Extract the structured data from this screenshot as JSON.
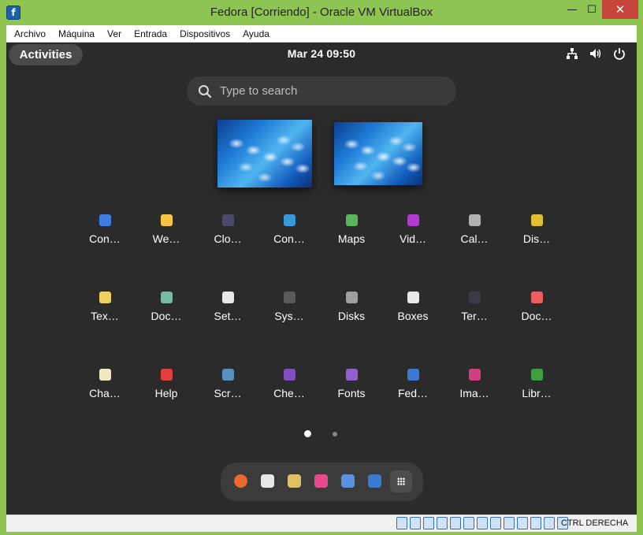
{
  "window": {
    "title": "Fedora [Corriendo] - Oracle VM VirtualBox",
    "minimize": "—",
    "maximize": "☐",
    "close": "✕"
  },
  "menubar": {
    "items": [
      "Archivo",
      "Máquina",
      "Ver",
      "Entrada",
      "Dispositivos",
      "Ayuda"
    ]
  },
  "gnome": {
    "activities_label": "Activities",
    "clock": "Mar 24  09:50",
    "search_placeholder": "Type to search",
    "status_icons": [
      "network-icon",
      "volume-icon",
      "power-icon"
    ]
  },
  "workspaces": [
    "workspace-1",
    "workspace-2"
  ],
  "apps": [
    {
      "label": "Con…",
      "icon": "contacts-icon",
      "color": "#3d7ee0"
    },
    {
      "label": "We…",
      "icon": "weather-icon",
      "color": "#f5c542"
    },
    {
      "label": "Clo…",
      "icon": "clocks-icon",
      "color": "#4a4a6a"
    },
    {
      "label": "Con…",
      "icon": "connections-icon",
      "color": "#3a9ad9"
    },
    {
      "label": "Maps",
      "icon": "maps-icon",
      "color": "#5ab55a"
    },
    {
      "label": "Vid…",
      "icon": "videos-icon",
      "color": "#b03ad0"
    },
    {
      "label": "Cal…",
      "icon": "calculator-icon",
      "color": "#b0b0b0"
    },
    {
      "label": "Dis…",
      "icon": "disk-usage-icon",
      "color": "#e0c030"
    },
    {
      "label": "Tex…",
      "icon": "text-editor-icon",
      "color": "#f0d060"
    },
    {
      "label": "Doc…",
      "icon": "document-scanner-icon",
      "color": "#7ab8a8"
    },
    {
      "label": "Set…",
      "icon": "settings-icon",
      "color": "#e8e8e8"
    },
    {
      "label": "Sys…",
      "icon": "system-monitor-icon",
      "color": "#5a5a5a"
    },
    {
      "label": "Disks",
      "icon": "disks-icon",
      "color": "#a0a0a0"
    },
    {
      "label": "Boxes",
      "icon": "boxes-icon",
      "color": "#e8e8e8"
    },
    {
      "label": "Ter…",
      "icon": "terminal-icon",
      "color": "#3a3a4a"
    },
    {
      "label": "Doc…",
      "icon": "document-viewer-icon",
      "color": "#e86060"
    },
    {
      "label": "Cha…",
      "icon": "characters-icon",
      "color": "#f0e8c0"
    },
    {
      "label": "Help",
      "icon": "help-icon",
      "color": "#e04040"
    },
    {
      "label": "Scr…",
      "icon": "screenshot-icon",
      "color": "#5a90c0"
    },
    {
      "label": "Che…",
      "icon": "cheese-icon",
      "color": "#8050c0"
    },
    {
      "label": "Fonts",
      "icon": "fonts-icon",
      "color": "#9060d0"
    },
    {
      "label": "Fed…",
      "icon": "fedora-media-writer-icon",
      "color": "#3a7ad0"
    },
    {
      "label": "Ima…",
      "icon": "image-viewer-icon",
      "color": "#d04080"
    },
    {
      "label": "Libr…",
      "icon": "libreoffice-calc-icon",
      "color": "#40a040"
    }
  ],
  "dash": [
    {
      "icon": "firefox-icon",
      "color": "#e86a2c"
    },
    {
      "icon": "calendar-icon",
      "color": "#e8e8e8"
    },
    {
      "icon": "rhythmbox-icon",
      "color": "#e0c060"
    },
    {
      "icon": "software-icon",
      "color": "#e84a8a"
    },
    {
      "icon": "files-icon",
      "color": "#5a90e0"
    },
    {
      "icon": "fedora-media-writer-icon",
      "color": "#3a7ad0"
    },
    {
      "icon": "show-apps-icon",
      "color": "#4e4e4e"
    }
  ],
  "statusbar": {
    "host_key": "CTRL DERECHA",
    "icon_count": 13
  }
}
